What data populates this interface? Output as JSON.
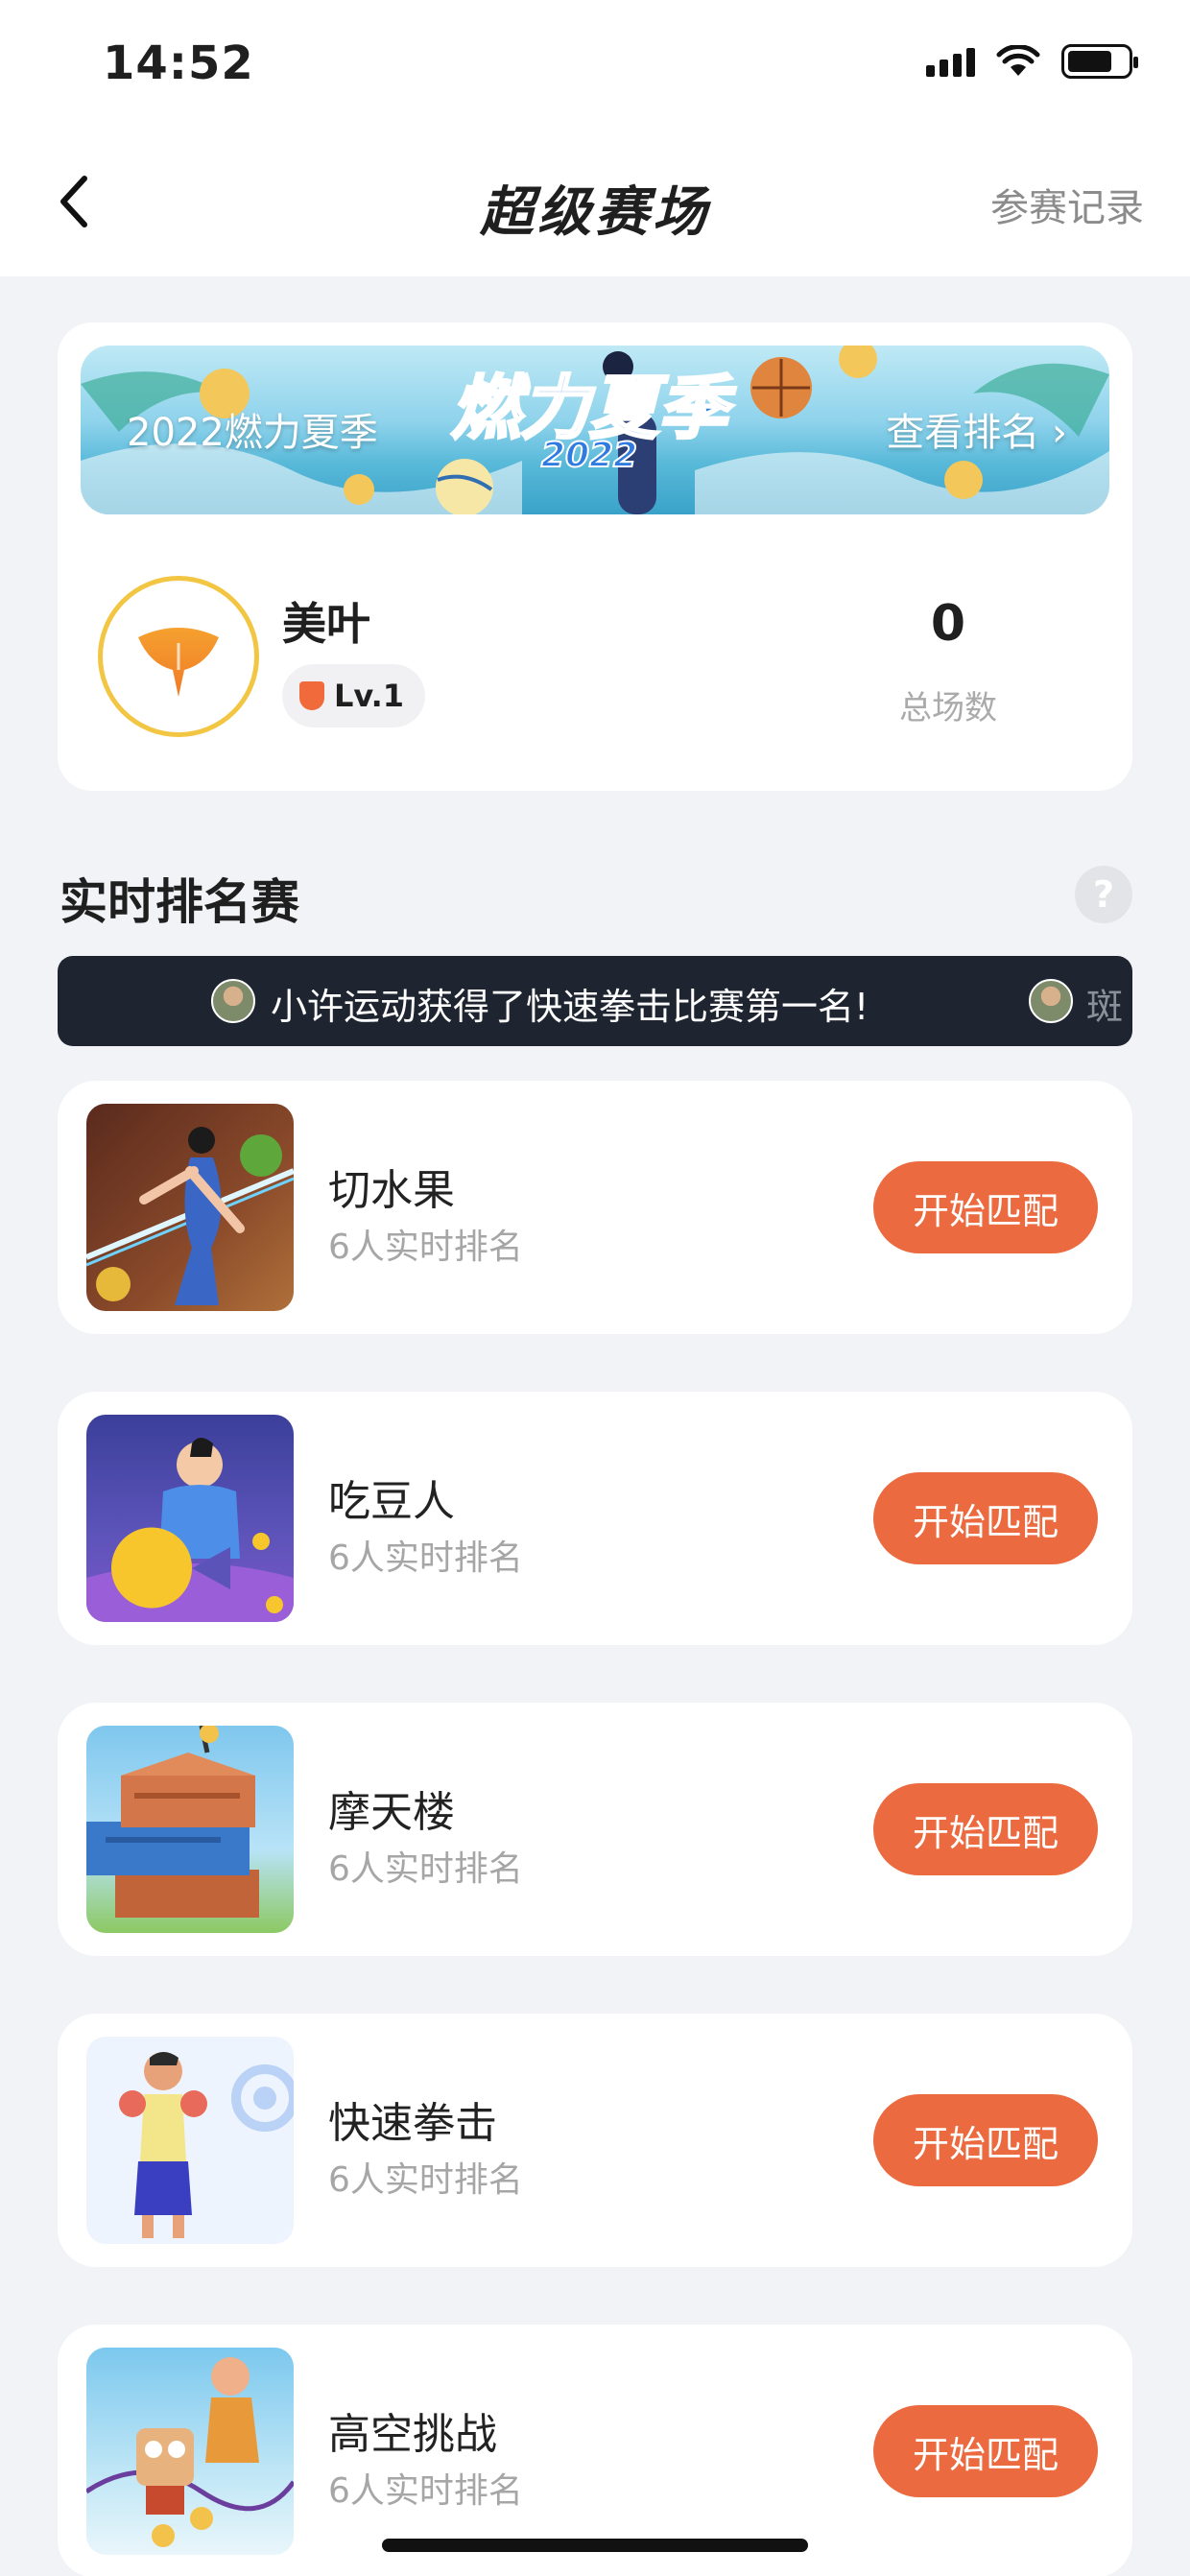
{
  "status_bar": {
    "time": "14:52"
  },
  "nav": {
    "title": "超级赛场",
    "right_link": "参赛记录"
  },
  "banner": {
    "left_text": "2022燃力夏季",
    "center_logo_text": "燃力夏季",
    "center_logo_year": "2022",
    "right_link": "查看排名"
  },
  "profile": {
    "name": "美叶",
    "level": "Lv.1",
    "total_count": "0",
    "total_label": "总场数"
  },
  "section": {
    "title": "实时排名赛",
    "help": "?"
  },
  "ticker": {
    "message": "小许运动获得了快速拳击比赛第一名!",
    "next_message": "斑"
  },
  "games": [
    {
      "name": "切水果",
      "subtitle": "6人实时排名",
      "button": "开始匹配"
    },
    {
      "name": "吃豆人",
      "subtitle": "6人实时排名",
      "button": "开始匹配"
    },
    {
      "name": "摩天楼",
      "subtitle": "6人实时排名",
      "button": "开始匹配"
    },
    {
      "name": "快速拳击",
      "subtitle": "6人实时排名",
      "button": "开始匹配"
    },
    {
      "name": "高空挑战",
      "subtitle": "6人实时排名",
      "button": "开始匹配"
    }
  ],
  "colors": {
    "accent": "#ec6a3f",
    "ticker_bg": "#1f2530",
    "page_bg": "#f2f3f6"
  }
}
